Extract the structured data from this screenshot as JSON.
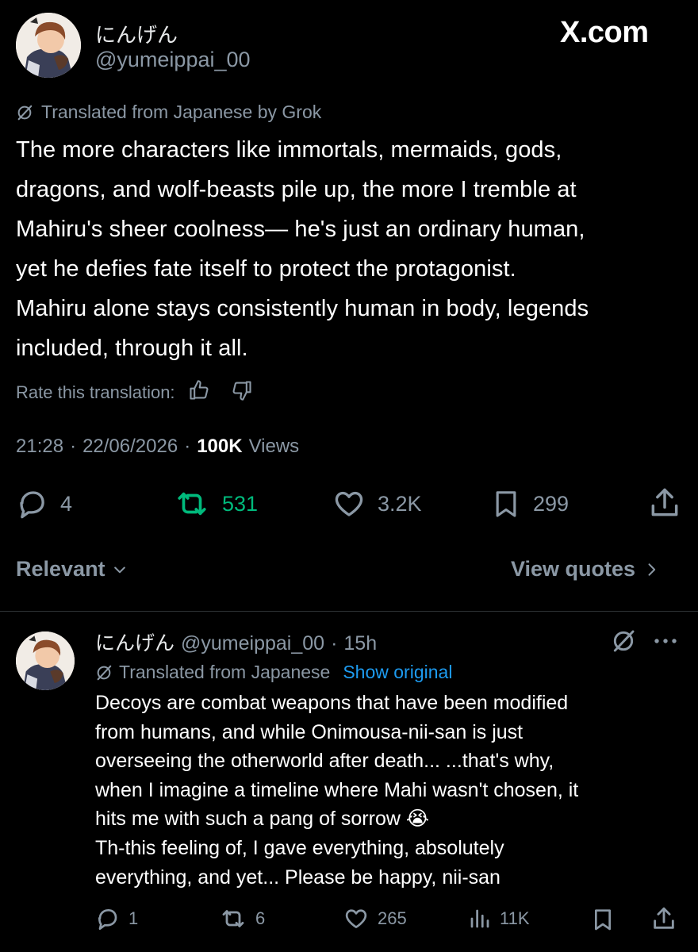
{
  "header": {
    "display_name": "にんげん",
    "handle": "@yumeippai_00",
    "brand": "X.com"
  },
  "post": {
    "translated_label": "Translated from Japanese by Grok",
    "text_lines": [
      "The more characters like immortals, mermaids, gods,",
      "dragons, and wolf-beasts pile up, the more I tremble at",
      "Mahiru's sheer coolness— he's just an ordinary human,",
      "yet he defies fate itself to protect the protagonist.",
      "Mahiru alone stays consistently human in body, legends",
      "included, through it all."
    ],
    "rate_label": "Rate this translation:",
    "time": "21:28",
    "date": "22/06/2026",
    "views_count": "100K",
    "views_label": "Views",
    "separator": "·",
    "stats": {
      "replies": "4",
      "reposts": "531",
      "likes": "3.2K",
      "bookmarks": "299"
    },
    "repost_color": "#00ba7c"
  },
  "sort": {
    "relevant_label": "Relevant",
    "view_quotes_label": "View quotes"
  },
  "reply": {
    "display_name": "にんげん",
    "handle": "@yumeippai_00",
    "time_ago": "15h",
    "translated_label": "Translated from Japanese",
    "show_original": "Show original",
    "text_lines": [
      "Decoys are combat weapons that have been modified",
      "from humans, and while Onimousa-nii-san is just",
      "overseeing the otherworld after death... ...that's why,",
      "when I imagine a timeline where Mahi wasn't chosen, it",
      "hits me with such a pang of sorrow 😭",
      "Th-this feeling of, I gave everything, absolutely",
      "everything, and yet... Please be happy, nii-san"
    ],
    "stats": {
      "replies": "1",
      "reposts": "6",
      "likes": "265",
      "views": "11K"
    },
    "link_color": "#1d9bf0"
  }
}
